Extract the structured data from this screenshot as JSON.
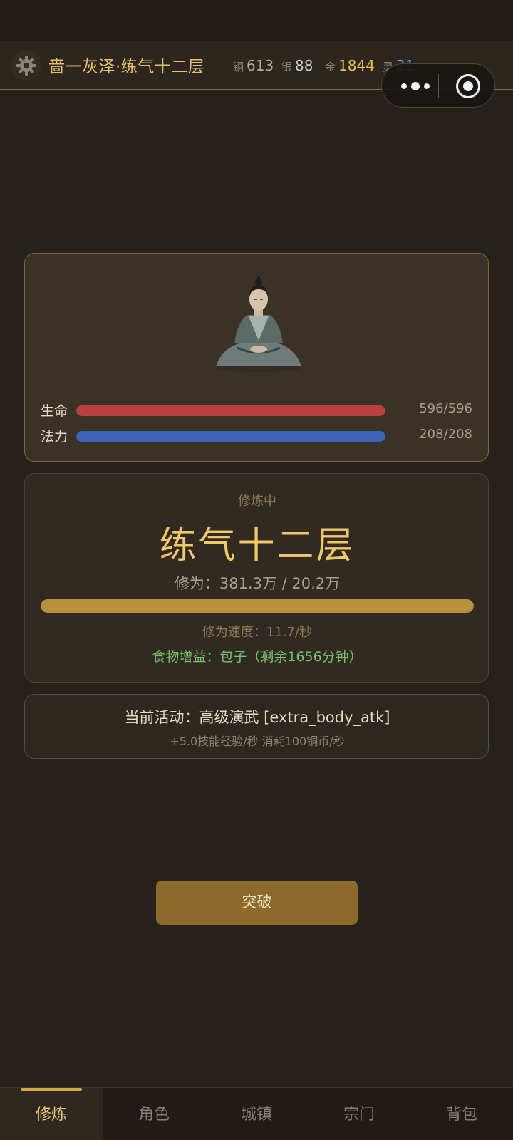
{
  "header": {
    "title": "啬一灰泽·练气十二层",
    "currencies": [
      {
        "label": "铜",
        "value": "613"
      },
      {
        "label": "银",
        "value": "88"
      },
      {
        "label": "金",
        "value": "1844"
      },
      {
        "label": "灵",
        "value": "21"
      }
    ]
  },
  "character": {
    "hp": {
      "label": "生命",
      "value": "596/596",
      "fill_percent": 100
    },
    "mp": {
      "label": "法力",
      "value": "208/208",
      "fill_percent": 100
    }
  },
  "cultivation": {
    "status": "修炼中",
    "realm": "练气十二层",
    "xp_text": "修为：381.3万 / 20.2万",
    "xp_fill_percent": 100,
    "speed_text": "修为速度：11.7/秒",
    "food_text": "食物增益：包子（剩余1656分钟）"
  },
  "activity": {
    "main_text": "当前活动：高级演武 [extra_body_atk]",
    "sub_text": "+5.0技能经验/秒   消耗100铜币/秒"
  },
  "actions": {
    "breakthrough_label": "突破"
  },
  "tabs": [
    {
      "label": "修炼",
      "active": true
    },
    {
      "label": "角色",
      "active": false
    },
    {
      "label": "城镇",
      "active": false
    },
    {
      "label": "宗门",
      "active": false
    },
    {
      "label": "背包",
      "active": false
    }
  ],
  "colors": {
    "accent_gold": "#e6c170",
    "hp": "#b8403e",
    "mp": "#3e64b8",
    "xp": "#b9913e",
    "food": "#79c46b",
    "breakthrough": "#8c6b2a"
  }
}
